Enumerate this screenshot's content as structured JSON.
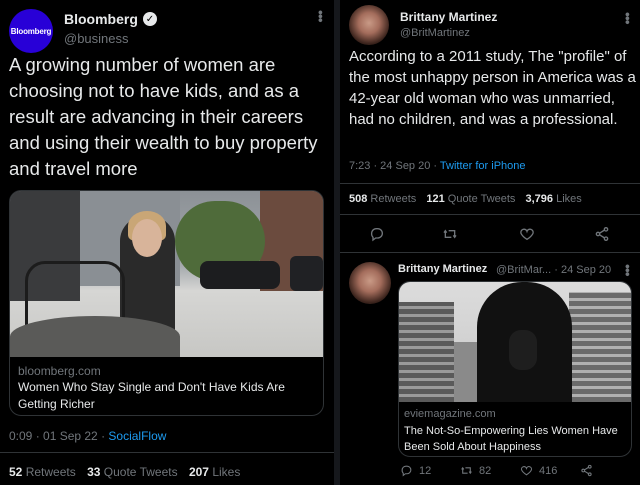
{
  "left_tweet": {
    "avatar_label": "Bloomberg",
    "name": "Bloomberg",
    "verified_mark": "✓",
    "handle": "@business",
    "text": "A growing number of women are choosing not to have kids, and as a result are advancing in their careers and using their wealth to buy property and travel more",
    "card": {
      "domain": "bloomberg.com",
      "title": "Women Who Stay Single and Don't Have Kids Are Getting Richer"
    },
    "time": "0:09 · 01 Sep 22 · ",
    "source": "SocialFlow",
    "retweets_count": "52",
    "retweets_label": "Retweets",
    "quotes_count": "33",
    "quotes_label": "Quote Tweets",
    "likes_count": "207",
    "likes_label": "Likes"
  },
  "right_tweet": {
    "name": "Brittany Martinez",
    "handle": "@BritMartinez",
    "text": "According to a 2011 study, The \"profile\" of the most unhappy person in America was a 42-year old woman who was unmarried, had no children, and was a professional.",
    "time": "7:23 · 24 Sep 20 · ",
    "source": "Twitter for iPhone",
    "retweets_count": "508",
    "retweets_label": "Retweets",
    "quotes_count": "121",
    "quotes_label": "Quote Tweets",
    "likes_count": "3,796",
    "likes_label": "Likes"
  },
  "reply_tweet": {
    "name": "Brittany Martinez",
    "handle_time": "@BritMar... · 24 Sep 20",
    "card": {
      "domain": "eviemagazine.com",
      "title": "The Not-So-Empowering Lies Women Have Been Sold About Happiness"
    },
    "replies": "12",
    "retweets": "82",
    "likes": "416"
  },
  "icons": {
    "more": "more-icon",
    "reply": "reply-icon",
    "retweet": "retweet-icon",
    "like": "like-icon",
    "share": "share-icon"
  },
  "colors": {
    "background": "#000000",
    "text": "#e7e9ea",
    "muted": "#71767b",
    "link": "#1d9bf0",
    "bloomberg_brand": "#2800d7"
  }
}
